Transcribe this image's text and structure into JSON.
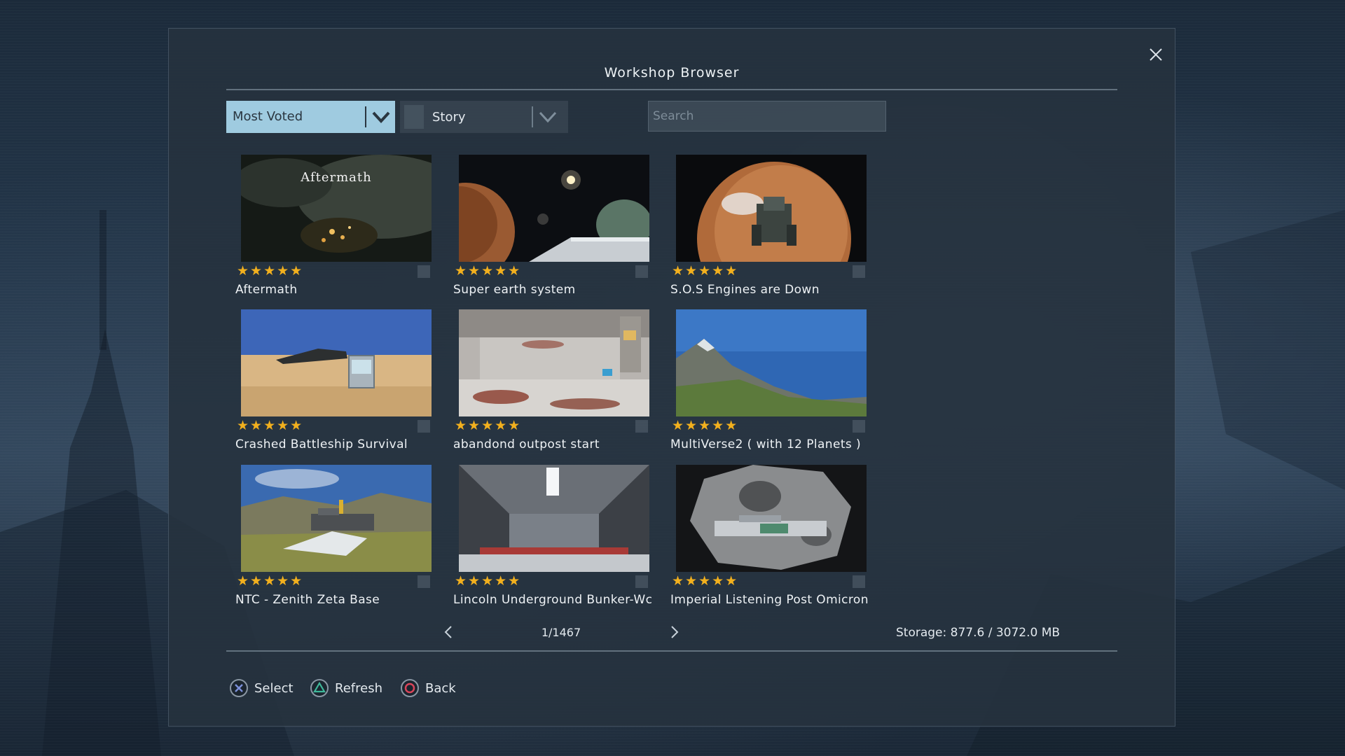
{
  "dialog": {
    "title": "Workshop Browser"
  },
  "filters": {
    "sort": "Most Voted",
    "category": "Story",
    "search_placeholder": "Search",
    "search_value": ""
  },
  "items": [
    {
      "name": "Aftermath",
      "rating": 5,
      "thumb_text": "Aftermath",
      "thumb": "aftermath-icon"
    },
    {
      "name": "Super earth system",
      "rating": 5,
      "thumb": "planets-icon"
    },
    {
      "name": "S.O.S Engines are Down",
      "rating": 5,
      "thumb": "mars-ship-icon"
    },
    {
      "name": "Crashed Battleship Survival",
      "rating": 5,
      "thumb": "desert-icon"
    },
    {
      "name": "abandond outpost start",
      "rating": 5,
      "thumb": "interior-icon"
    },
    {
      "name": "MultiVerse2  ( with 12 Planets )",
      "rating": 5,
      "thumb": "mountain-icon"
    },
    {
      "name": "NTC - Zenith Zeta Base",
      "rating": 5,
      "thumb": "base-icon"
    },
    {
      "name": "Lincoln Underground Bunker-Wc",
      "rating": 5,
      "thumb": "bunker-icon"
    },
    {
      "name": "Imperial Listening Post Omicron",
      "rating": 5,
      "thumb": "asteroid-icon"
    }
  ],
  "stars_text": "★★★★★",
  "pagination": {
    "page": "1/1467"
  },
  "storage": "Storage: 877.6 / 3072.0 MB",
  "hints": {
    "select": "Select",
    "refresh": "Refresh",
    "back": "Back"
  },
  "colors": {
    "accent": "#9fcbe0",
    "star": "#f2b01e",
    "cross": "#7b8fd8",
    "triangle": "#3fb79a",
    "circle": "#d8455a"
  }
}
